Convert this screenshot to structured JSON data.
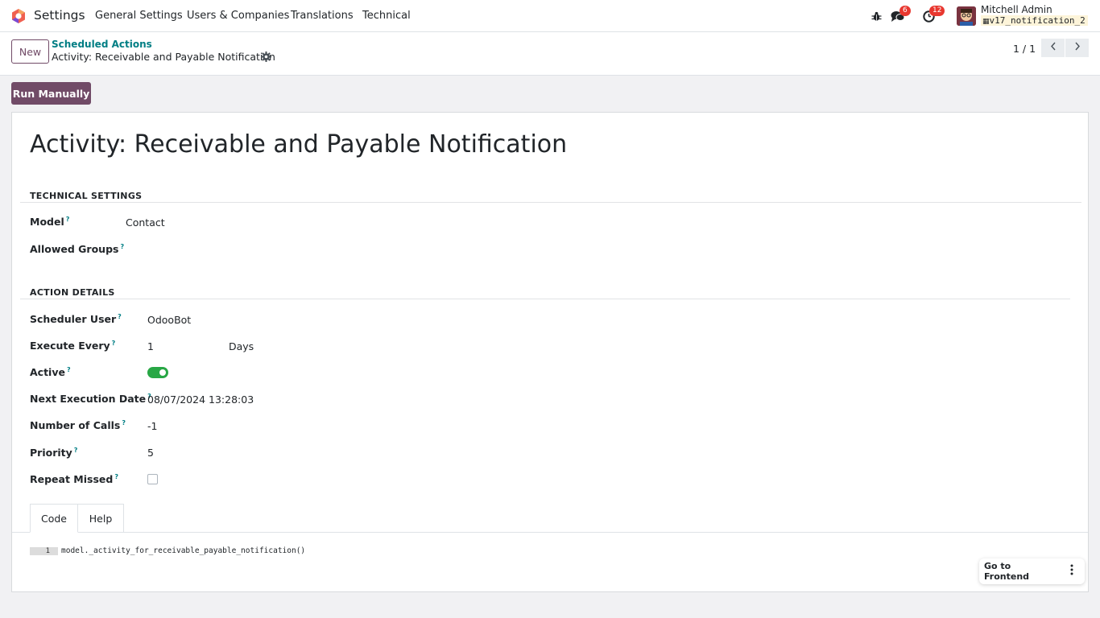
{
  "navbar": {
    "app_name": "Settings",
    "menu": [
      {
        "label": "General Settings"
      },
      {
        "label": "Users & Companies"
      },
      {
        "label": "Translations"
      },
      {
        "label": "Technical"
      }
    ],
    "messages_count": "6",
    "activities_count": "12",
    "user_name": "Mitchell Admin",
    "database": "v17_notification_2"
  },
  "control_panel": {
    "new_label": "New",
    "breadcrumb_parent": "Scheduled Actions",
    "breadcrumb_current": "Activity: Receivable and Payable Notification",
    "pager": "1 / 1"
  },
  "actions": {
    "run_manually": "Run Manually"
  },
  "form": {
    "title": "Activity: Receivable and Payable Notification",
    "technical_settings": {
      "heading": "TECHNICAL SETTINGS",
      "model_label": "Model",
      "model_value": "Contact",
      "groups_label": "Allowed Groups"
    },
    "action_details": {
      "heading": "ACTION DETAILS",
      "scheduler_user_label": "Scheduler User",
      "scheduler_user_value": "OdooBot",
      "execute_every_label": "Execute Every",
      "execute_every_value": "1",
      "execute_every_unit": "Days",
      "active_label": "Active",
      "active": true,
      "next_exec_label": "Next Execution Date",
      "next_exec_value": "08/07/2024 13:28:03",
      "num_calls_label": "Number of Calls",
      "num_calls_value": "-1",
      "priority_label": "Priority",
      "priority_value": "5",
      "repeat_missed_label": "Repeat Missed",
      "repeat_missed": false
    },
    "help_mark": "?",
    "tabs": [
      {
        "label": "Code"
      },
      {
        "label": "Help"
      }
    ],
    "code": {
      "line_number": "1",
      "line": "model._activity_for_receivable_payable_notification()"
    }
  },
  "footer": {
    "go_to_frontend": "Go to Frontend"
  },
  "colors": {
    "brand": "#714b67",
    "link": "#017e84",
    "toggle_on": "#28a745",
    "badge": "#e8372f"
  }
}
